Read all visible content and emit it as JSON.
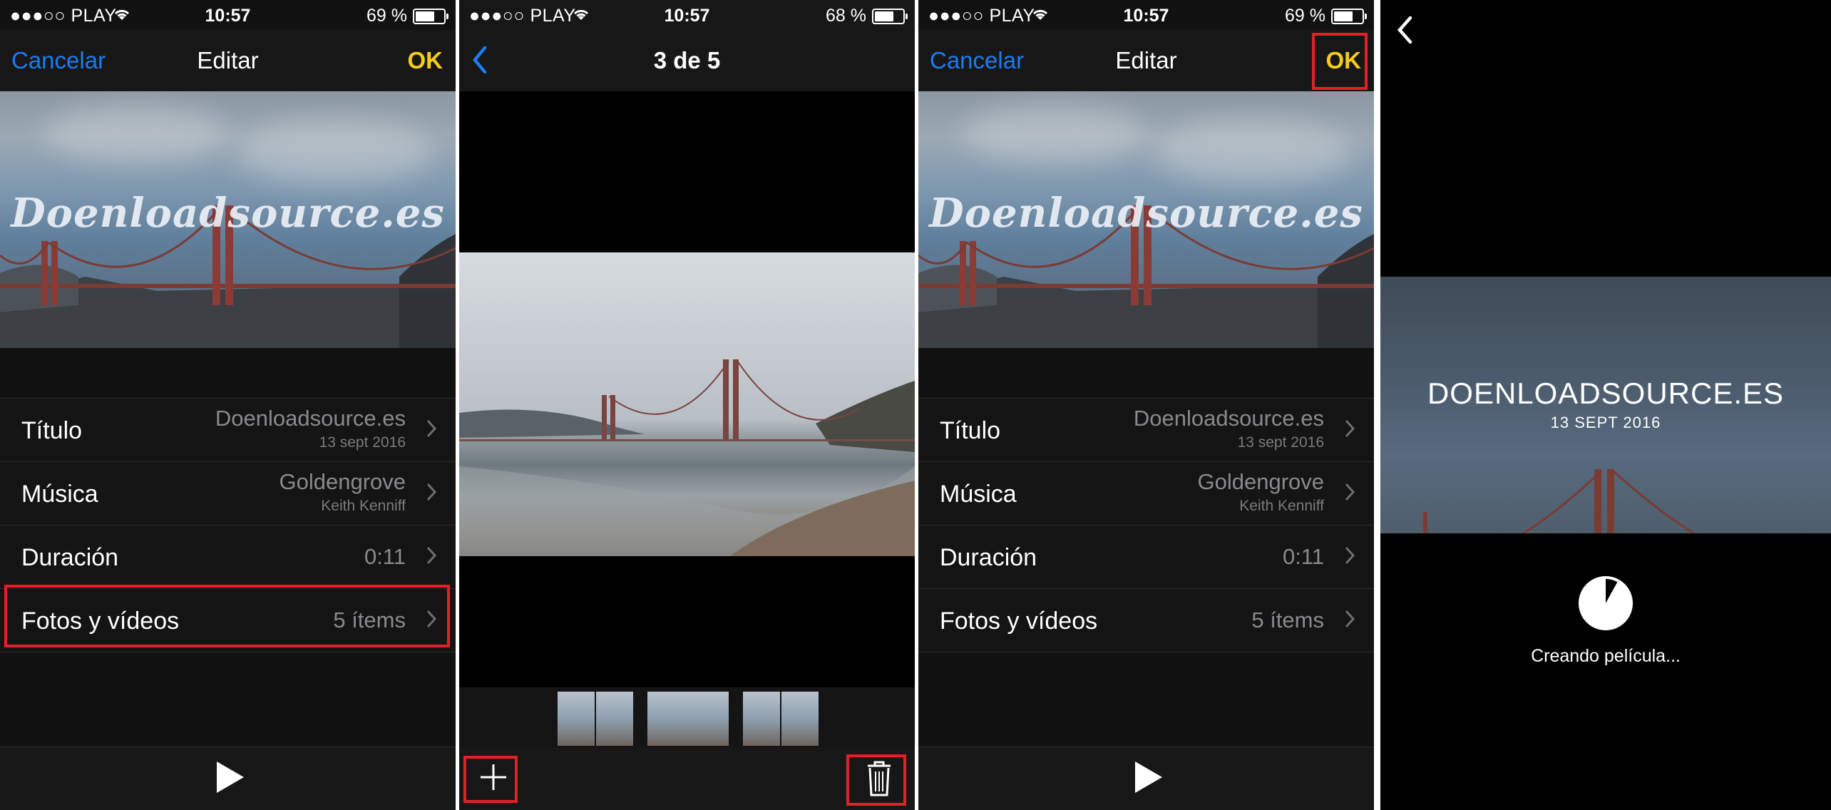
{
  "panel1": {
    "status": {
      "carrier": "●●●○○ PLAY",
      "time": "10:57",
      "battery": "69 %",
      "battery_level": 0.69
    },
    "nav": {
      "cancel": "Cancelar",
      "title": "Editar",
      "ok": "OK"
    },
    "watermark": "Doenloadsource.es",
    "rows": [
      {
        "label": "Título",
        "value": "Doenloadsource.es",
        "sub": "13 sept 2016"
      },
      {
        "label": "Música",
        "value": "Goldengrove",
        "sub": "Keith Kenniff"
      },
      {
        "label": "Duración",
        "value": "0:11"
      },
      {
        "label": "Fotos y vídeos",
        "value": "5 ítems"
      }
    ]
  },
  "panel2": {
    "status": {
      "carrier": "●●●○○ PLAY",
      "time": "10:57",
      "battery": "68 %",
      "battery_level": 0.68
    },
    "title": "3 de 5"
  },
  "panel3": {
    "status": {
      "carrier": "●●●○○ PLAY",
      "time": "10:57",
      "battery": "69 %",
      "battery_level": 0.69
    },
    "nav": {
      "cancel": "Cancelar",
      "title": "Editar",
      "ok": "OK"
    },
    "watermark": "Doenloadsource.es",
    "rows": [
      {
        "label": "Título",
        "value": "Doenloadsource.es",
        "sub": "13 sept 2016"
      },
      {
        "label": "Música",
        "value": "Goldengrove",
        "sub": "Keith Kenniff"
      },
      {
        "label": "Duración",
        "value": "0:11"
      },
      {
        "label": "Fotos y vídeos",
        "value": "5 ítems"
      }
    ]
  },
  "panel4": {
    "title": "DOENLOADSOURCE.ES",
    "date": "13 SEPT 2016",
    "status_text": "Creando película...",
    "progress": 0.08
  },
  "colors": {
    "accent_blue": "#1b7cf3",
    "ok_yellow": "#f5cc1a",
    "highlight_red": "#e3202a"
  },
  "icons": [
    "wifi-icon",
    "battery-icon",
    "chevron-right-icon",
    "back-chevron-icon",
    "play-icon",
    "plus-icon",
    "trash-icon",
    "progress-icon"
  ]
}
